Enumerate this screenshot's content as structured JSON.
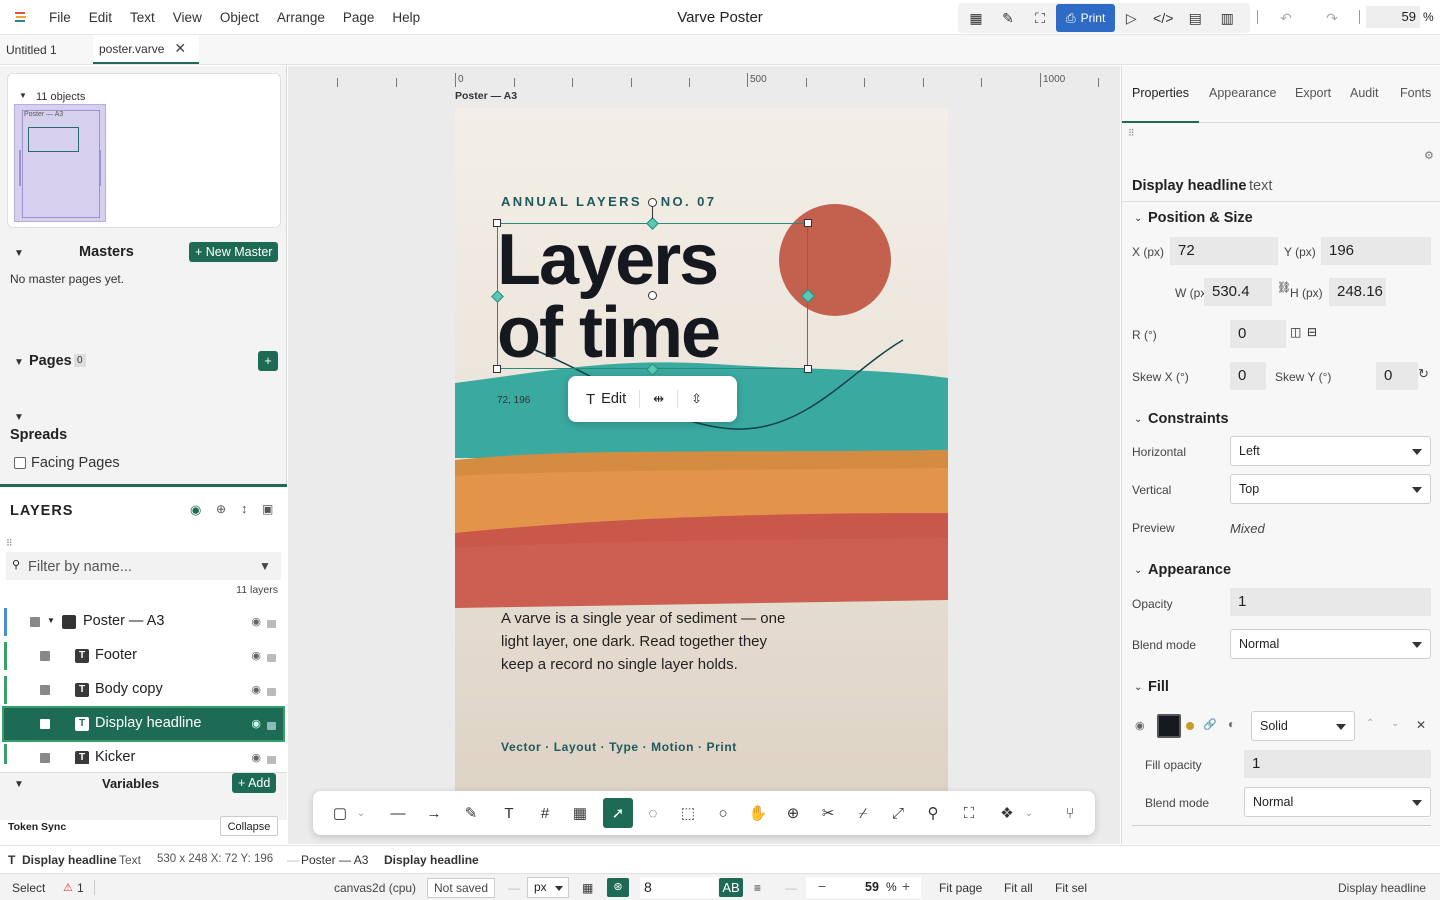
{
  "menu": [
    "File",
    "Edit",
    "Text",
    "View",
    "Object",
    "Arrange",
    "Page",
    "Help"
  ],
  "app_title": "Varve Poster",
  "toolbar_top": {
    "print_label": "Print",
    "zoom_value": "59",
    "zoom_unit": "%"
  },
  "tabs": [
    {
      "label": "Untitled 1"
    },
    {
      "label": "poster.varve"
    }
  ],
  "left": {
    "objects_count": "11 objects",
    "thumb_label": "Poster — A3",
    "masters_title": "Masters",
    "new_master": "+ New Master",
    "no_masters": "No master pages yet.",
    "pages_title": "Pages",
    "pages_count": "0",
    "pages_add": "+",
    "spreads_title": "Spreads",
    "facing_pages": "Facing Pages",
    "layers_title": "LAYERS",
    "filter_placeholder": "Filter by name...",
    "layers_count": "11 layers",
    "layers": [
      {
        "name": "Poster — A3"
      },
      {
        "name": "Footer"
      },
      {
        "name": "Body copy"
      },
      {
        "name": "Display headline"
      },
      {
        "name": "Kicker"
      }
    ],
    "variables_title": "Variables",
    "variables_add": "+ Add",
    "token_sync": "Token Sync",
    "collapse": "Collapse"
  },
  "canvas": {
    "ruler_labels": [
      "0",
      "500",
      "1000"
    ],
    "poster_label": "Poster — A3",
    "kicker": "ANNUAL LAYERS · NO. 07",
    "headline_line1": "Layers",
    "headline_line2": "of time",
    "coords": "72, 196",
    "edit_label": "Edit",
    "body_copy_line1": "A varve is a single year of sediment — one",
    "body_copy_line2": "light layer, one dark. Read together they",
    "body_copy_line3": "keep a record no single layer holds.",
    "footer": "Vector · Layout · Type · Motion · Print",
    "colors": {
      "teal": "#3aa9a0",
      "orange": "#e3944a",
      "red": "#c9574a",
      "sun": "#c4604e",
      "ink": "#16181f"
    }
  },
  "right": {
    "tabs": [
      "Properties",
      "Appearance",
      "Export",
      "Audit",
      "Fonts"
    ],
    "selection_name": "Display headline",
    "selection_type": "text",
    "position_size": "Position & Size",
    "x_label": "X (px)",
    "x_value": "72",
    "y_label": "Y (px)",
    "y_value": "196",
    "w_label": "W (px)",
    "w_value": "530.4",
    "h_label": "H (px)",
    "h_value": "248.16",
    "r_label": "R (°)",
    "r_value": "0",
    "skewx_label": "Skew X (°)",
    "skewx_value": "0",
    "skewy_label": "Skew Y (°)",
    "skewy_value": "0",
    "constraints": "Constraints",
    "horizontal_label": "Horizontal",
    "horizontal_value": "Left",
    "vertical_label": "Vertical",
    "vertical_value": "Top",
    "preview_label": "Preview",
    "preview_value": "Mixed",
    "appearance": "Appearance",
    "opacity_label": "Opacity",
    "opacity_value": "1",
    "blend_label": "Blend mode",
    "blend_value": "Normal",
    "fill": "Fill",
    "fill_type": "Solid",
    "fill_color": "#16181f",
    "fill_opacity_label": "Fill opacity",
    "fill_opacity_value": "1",
    "fill_blend_label": "Blend mode",
    "fill_blend_value": "Normal"
  },
  "status": {
    "sel_name": "Display headline",
    "sel_type": "Text",
    "sel_geom": "530 x 248 X: 72 Y: 196",
    "crumb_page": "Poster — A3",
    "crumb_obj": "Display headline",
    "mode": "Select",
    "warnings": "1",
    "renderer": "canvas2d (cpu)",
    "saved": "Not saved",
    "unit": "px",
    "grid_value": "8",
    "ab": "AB",
    "zoom": "59",
    "zoom_unit": "%",
    "fit_page": "Fit page",
    "fit_all": "Fit all",
    "fit_sel": "Fit sel",
    "right_label": "Display headline"
  }
}
